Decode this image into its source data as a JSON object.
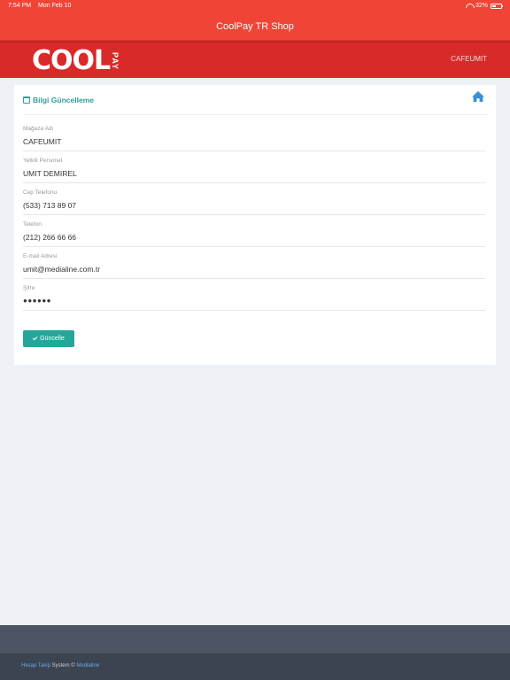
{
  "status_bar": {
    "time": "7:54 PM",
    "date": "Mon Feb 10",
    "battery": "32%",
    "battery_level": 0.32
  },
  "nav": {
    "title": "CoolPay TR Shop"
  },
  "brand": {
    "logo_main": "COOL",
    "logo_side": "PAY",
    "user": "CAFEUMIT"
  },
  "card": {
    "title": "Bilgi Güncelleme",
    "fields": [
      {
        "label": "Mağaza Adı",
        "value": "CAFEUMIT"
      },
      {
        "label": "Yetkili Personel",
        "value": "UMIT DEMIREL"
      },
      {
        "label": "Cep Telefonu",
        "value": "(533) 713 89 07"
      },
      {
        "label": "Telefon",
        "value": "(212) 266 66 66"
      },
      {
        "label": "E-mail Adresi",
        "value": "umit@medialine.com.tr"
      },
      {
        "label": "Şifre",
        "value": "●●●●●●"
      }
    ],
    "update_label": "Güncelle"
  },
  "footer": {
    "link1": "Hesap Takip",
    "middle": " System © ",
    "link2": "Medialine"
  },
  "colors": {
    "primary": "#f04437",
    "brand": "#d92a2a",
    "accent": "#26a69a",
    "home_icon": "#3a8fd8"
  }
}
